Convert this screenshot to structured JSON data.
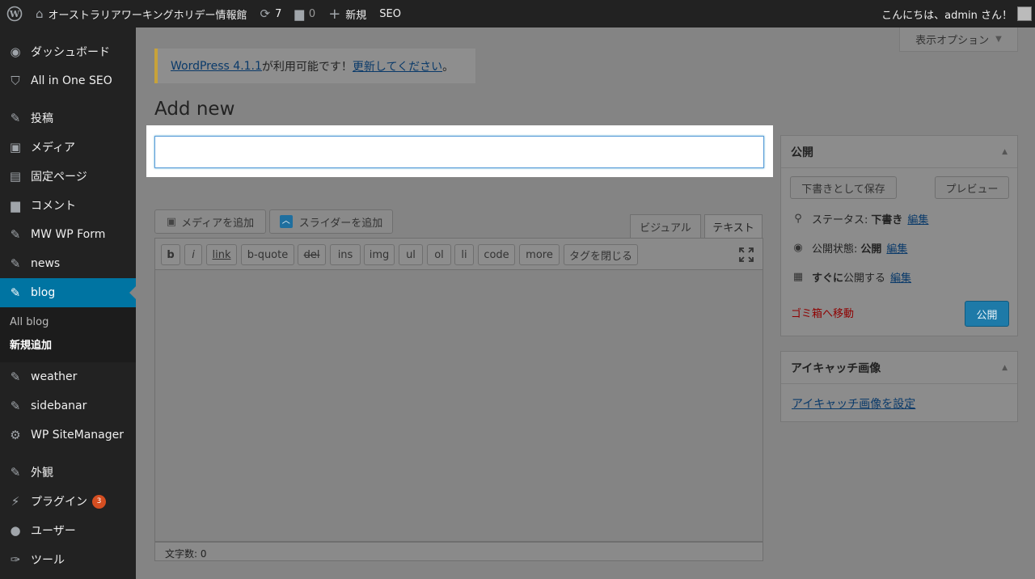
{
  "adminbar": {
    "site_name": "オーストラリアワーキングホリデー情報館",
    "updates_count": "7",
    "comments_count": "0",
    "new_label": "新規",
    "seo_label": "SEO",
    "greeting": "こんにちは、admin さん！"
  },
  "sidebar": {
    "items": [
      {
        "label": "ダッシュボード",
        "icon": "dashboard-icon"
      },
      {
        "label": "All in One SEO",
        "icon": "shield-icon"
      },
      {
        "label": "投稿",
        "icon": "pin-icon"
      },
      {
        "label": "メディア",
        "icon": "media-icon"
      },
      {
        "label": "固定ページ",
        "icon": "page-icon"
      },
      {
        "label": "コメント",
        "icon": "comment-icon"
      },
      {
        "label": "MW WP Form",
        "icon": "pin-icon"
      },
      {
        "label": "news",
        "icon": "pin-icon"
      },
      {
        "label": "blog",
        "icon": "pin-icon"
      },
      {
        "label": "weather",
        "icon": "pin-icon"
      },
      {
        "label": "sidebanar",
        "icon": "pin-icon"
      },
      {
        "label": "WP SiteManager",
        "icon": "gear-icon"
      },
      {
        "label": "外観",
        "icon": "brush-icon"
      },
      {
        "label": "プラグイン",
        "icon": "plugin-icon"
      },
      {
        "label": "ユーザー",
        "icon": "user-icon"
      },
      {
        "label": "ツール",
        "icon": "wrench-icon"
      }
    ],
    "plugin_badge": "3",
    "submenu": {
      "all": "All blog",
      "new": "新規追加"
    }
  },
  "screen_options": "表示オプション",
  "notice": {
    "version_link": "WordPress 4.1.1",
    "middle_text": " が利用可能です！",
    "update_link": "更新してください",
    "end_text": "。"
  },
  "page_title": "Add new",
  "title_input": {
    "value": "",
    "placeholder": ""
  },
  "editor": {
    "add_media": "メディアを追加",
    "add_slider": "スライダーを追加",
    "tab_visual": "ビジュアル",
    "tab_text": "テキスト",
    "quicktags": [
      "b",
      "i",
      "link",
      "b-quote",
      "del",
      "ins",
      "img",
      "ul",
      "ol",
      "li",
      "code",
      "more",
      "タグを閉じる"
    ],
    "word_count": "文字数: 0"
  },
  "publish": {
    "title": "公開",
    "save_draft": "下書きとして保存",
    "preview": "プレビュー",
    "status_label": "ステータス:",
    "status_value": "下書き",
    "visibility_label": "公開状態:",
    "visibility_value": "公開",
    "schedule_label": "すぐに",
    "schedule_suffix": "公開する",
    "edit": "編集",
    "trash": "ゴミ箱へ移動",
    "publish_button": "公開"
  },
  "thumbnail": {
    "title": "アイキャッチ画像",
    "set_link": "アイキャッチ画像を設定"
  }
}
